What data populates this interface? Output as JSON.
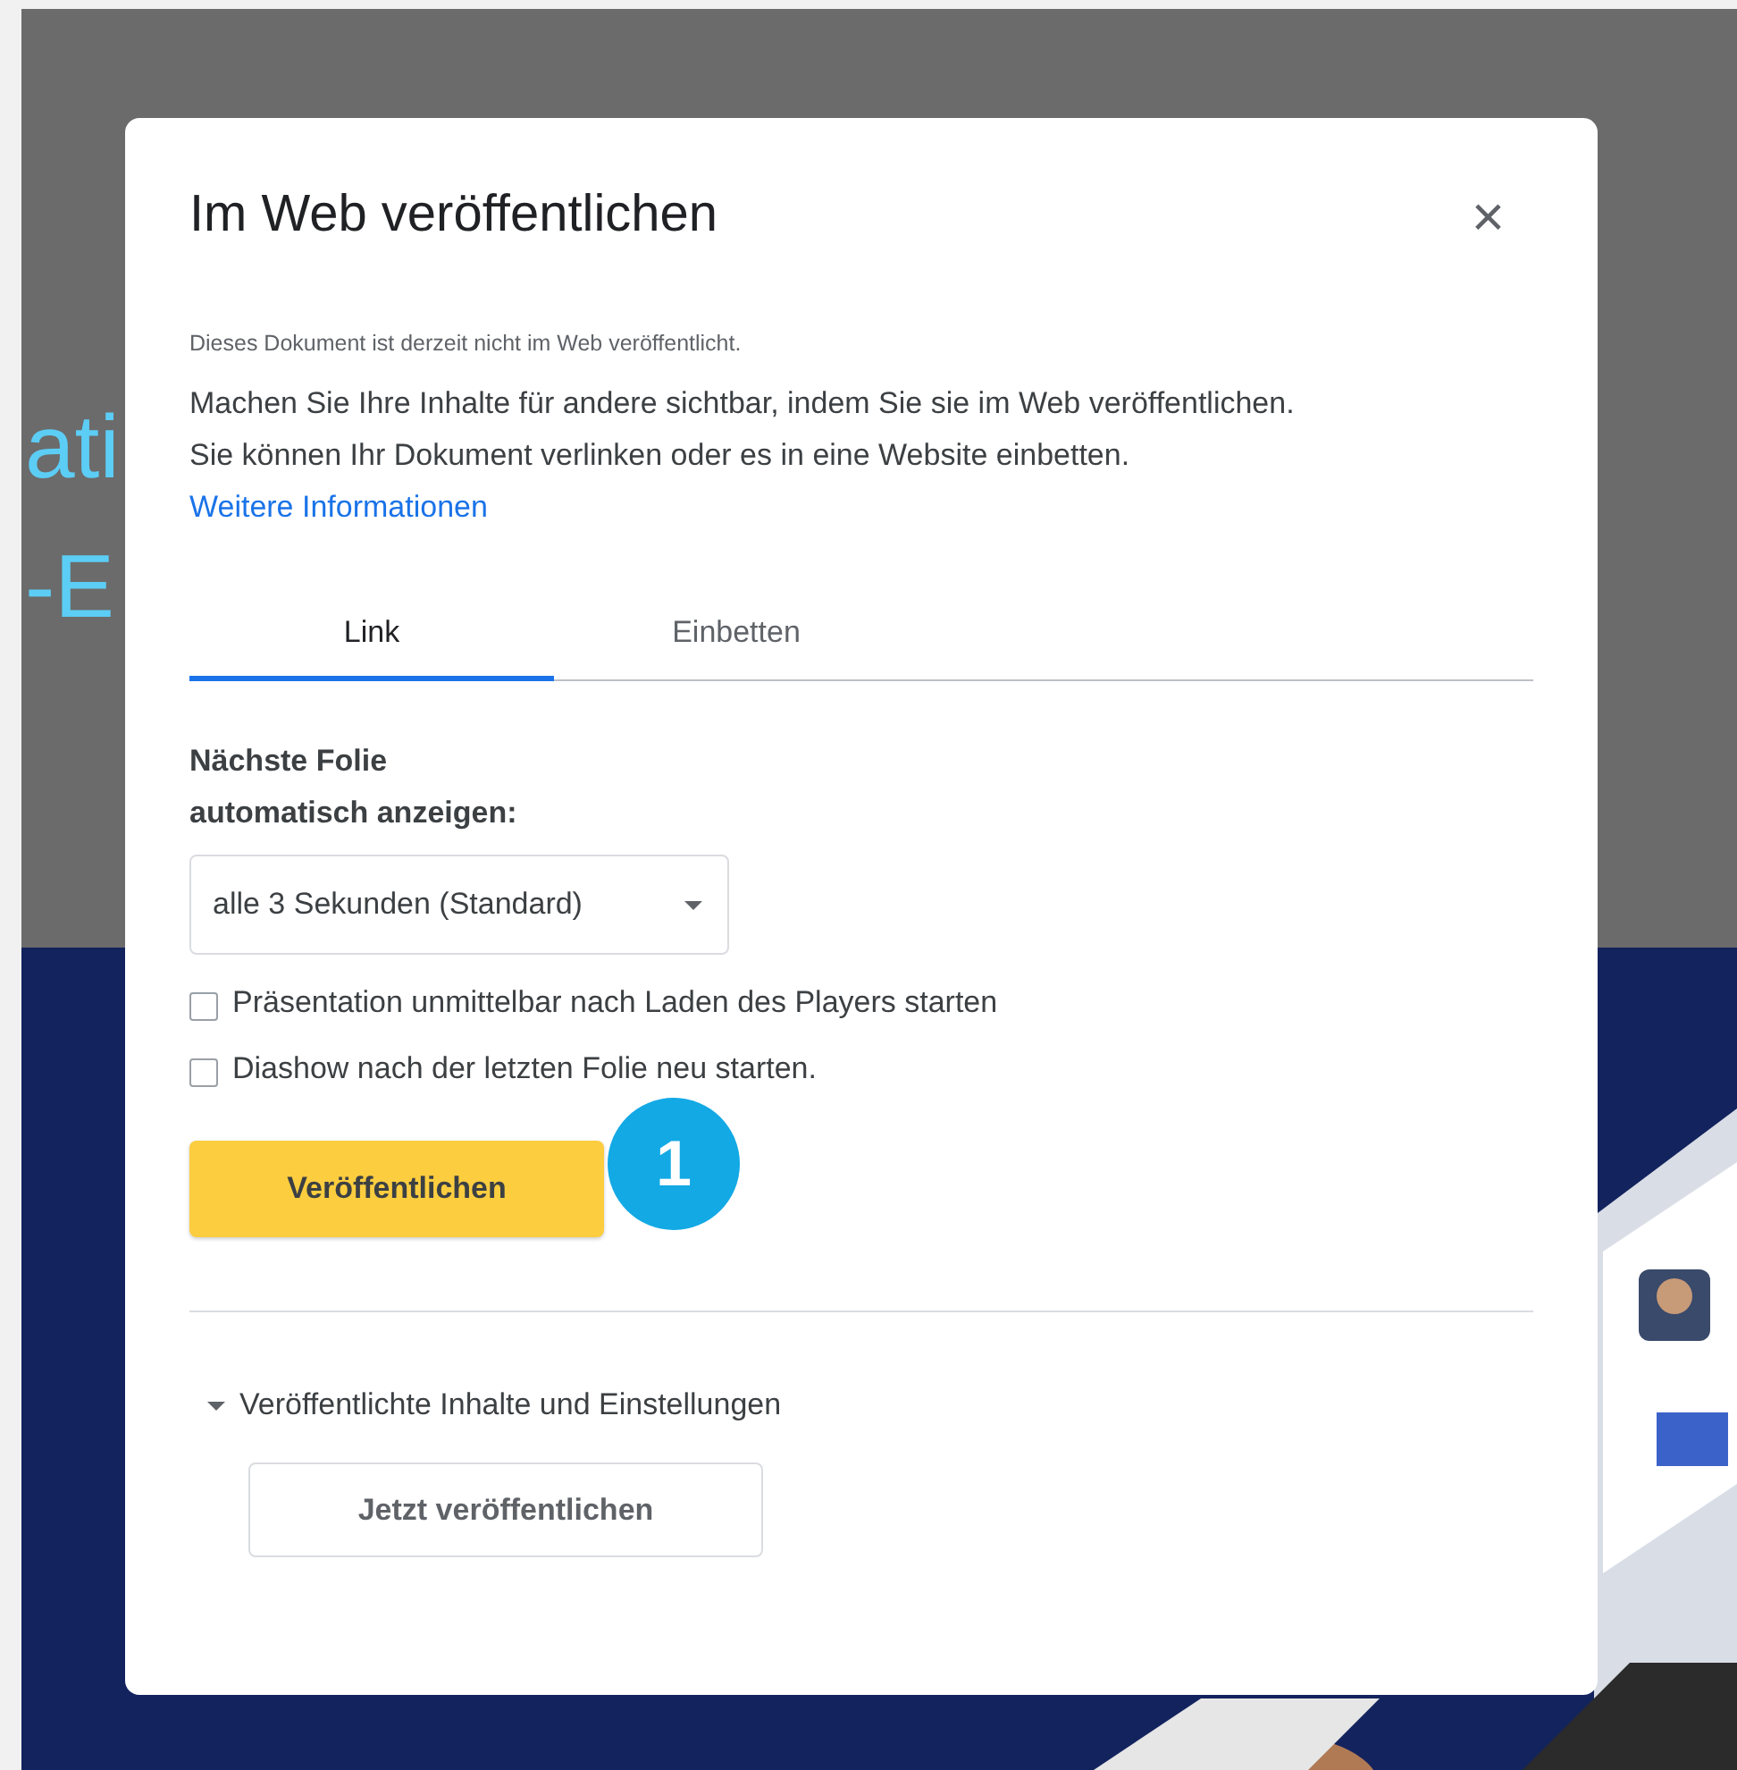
{
  "background": {
    "texts": [
      "ati",
      "-E"
    ]
  },
  "dialog": {
    "title": "Im Web veröffentlichen",
    "close": "×",
    "status": "Dieses Dokument ist derzeit nicht im Web veröffentlicht.",
    "description": "Machen Sie Ihre Inhalte für andere sichtbar, indem Sie sie im Web veröffentlichen. Sie können Ihr Dokument verlinken oder es in eine Website einbetten.",
    "link": "Weitere Informationen",
    "tabs": [
      {
        "label": "Link",
        "selected": true
      },
      {
        "label": "Einbetten",
        "selected": false
      }
    ],
    "advance_label": [
      "Nächste Folie",
      "automatisch anzeigen:"
    ],
    "advance_select": "alle 3 Sekunden (Standard)",
    "checkboxes": [
      {
        "label": "Präsentation unmittelbar nach Laden des Players starten",
        "checked": false
      },
      {
        "label": "Diashow nach der letzten Folie neu starten.",
        "checked": false
      }
    ],
    "publish_button": "Veröffentlichen",
    "step_badge": "1",
    "section": {
      "label": "Veröffentlichte Inhalte und Einstellungen",
      "expanded": true,
      "button": "Jetzt veröffentlichen"
    }
  }
}
